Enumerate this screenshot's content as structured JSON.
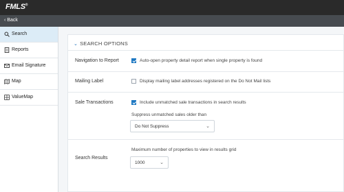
{
  "app": {
    "logo": "FMLS",
    "logo_mark": "®"
  },
  "nav": {
    "back_label": "Back"
  },
  "sidebar": {
    "items": [
      {
        "label": "Search",
        "icon": "search-icon",
        "active": true
      },
      {
        "label": "Reports",
        "icon": "document-icon",
        "active": false
      },
      {
        "label": "Email Signature",
        "icon": "envelope-icon",
        "active": false
      },
      {
        "label": "Map",
        "icon": "map-icon",
        "active": false
      },
      {
        "label": "ValueMap",
        "icon": "valuemap-icon",
        "active": false
      }
    ]
  },
  "section": {
    "title": "SEARCH OPTIONS",
    "nav_report": {
      "label": "Navigation to Report",
      "option": "Auto-open property detail report when single property is found",
      "checked": true
    },
    "mailing": {
      "label": "Mailing Label",
      "option": "Display mailing label addresses registered on the Do Not Mail lists",
      "checked": false
    },
    "sale": {
      "label": "Sale Transactions",
      "option": "Include unmatched sale transactions in search results",
      "checked": true,
      "suppress_label": "Suppress unmatched sales older than",
      "suppress_value": "Do Not Suppress"
    },
    "results": {
      "label": "Search Results",
      "max_label": "Maximum number of properties to view in results grid",
      "max_value": "1000"
    }
  },
  "colors": {
    "accent": "#1e78c2",
    "topbar": "#2a2a2a",
    "backbar": "#474b50",
    "active_item": "#dcecf7"
  }
}
